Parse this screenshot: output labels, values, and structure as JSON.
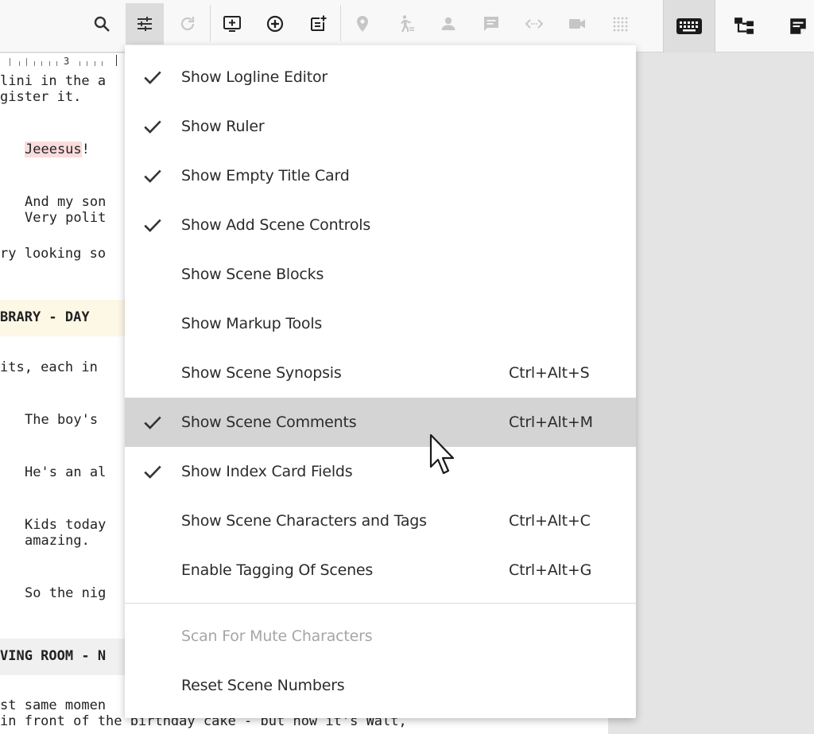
{
  "toolbar": {
    "left_icons": [
      "search-icon",
      "sliders-icon",
      "redo-icon",
      "add-screen-icon",
      "add-circle-icon",
      "add-note-icon",
      "location-pin-icon",
      "walking-person-icon",
      "person-icon",
      "chat-bubble-icon",
      "code-arrows-icon",
      "video-camera-icon",
      "grid-dots-icon"
    ],
    "right_icons": [
      "keyboard-icon",
      "hierarchy-icon",
      "note-icon"
    ]
  },
  "script": {
    "ruler_number": "3",
    "lines": [
      "lini in the a",
      "gister it.",
      "Jeeesus",
      "!",
      "And my son",
      "Very polit",
      "ry looking so",
      "BRARY - DAY",
      "its, each in",
      "The boy's",
      "He's an al",
      "Kids today",
      "amazing.",
      "So the nig",
      "VING ROOM - N",
      "st same momen",
      "in front of the birthday cake - but now it's Walt,"
    ]
  },
  "menu": {
    "items": [
      {
        "label": "Show Logline Editor",
        "checked": true,
        "shortcut": ""
      },
      {
        "label": "Show Ruler",
        "checked": true,
        "shortcut": ""
      },
      {
        "label": "Show Empty Title Card",
        "checked": true,
        "shortcut": ""
      },
      {
        "label": "Show Add Scene Controls",
        "checked": true,
        "shortcut": ""
      },
      {
        "label": "Show Scene Blocks",
        "checked": false,
        "shortcut": ""
      },
      {
        "label": "Show Markup Tools",
        "checked": false,
        "shortcut": ""
      },
      {
        "label": "Show Scene Synopsis",
        "checked": false,
        "shortcut": "Ctrl+Alt+S"
      },
      {
        "label": "Show Scene Comments",
        "checked": true,
        "shortcut": "Ctrl+Alt+M"
      },
      {
        "label": "Show Index Card Fields",
        "checked": true,
        "shortcut": ""
      },
      {
        "label": "Show Scene Characters and Tags",
        "checked": false,
        "shortcut": "Ctrl+Alt+C"
      },
      {
        "label": "Enable Tagging Of Scenes",
        "checked": false,
        "shortcut": "Ctrl+Alt+G"
      }
    ],
    "actions": [
      {
        "label": "Scan For Mute Characters",
        "disabled": true
      },
      {
        "label": "Reset Scene Numbers",
        "disabled": false
      }
    ]
  },
  "colors": {
    "highlight": "#fbdcdc",
    "heading_bg_1": "#fdf8e6",
    "heading_bg_2": "#f0f0f0",
    "menu_hover": "#d4d4d4",
    "toolbar_bg": "#f8f8f8"
  }
}
